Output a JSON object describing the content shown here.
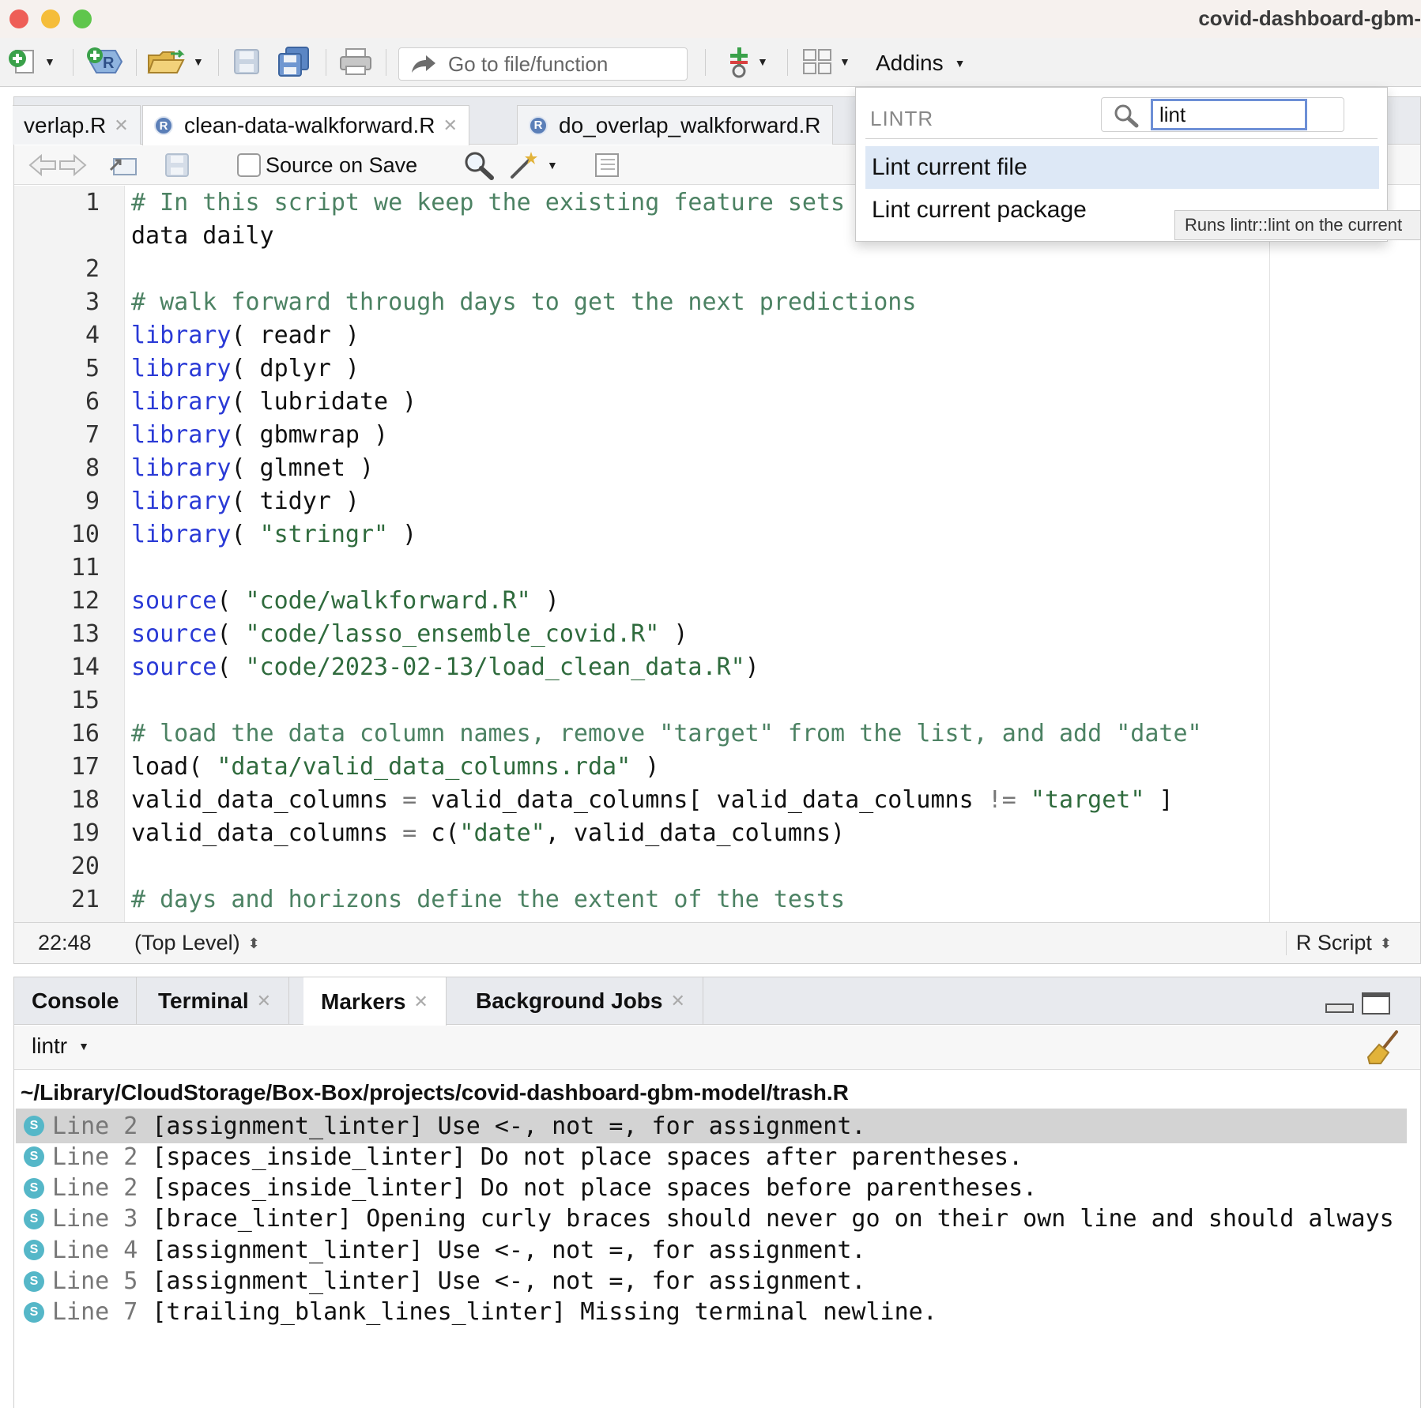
{
  "window": {
    "title": "covid-dashboard-gbm-"
  },
  "toolbar": {
    "goto_placeholder": "Go to file/function",
    "addins_label": "Addins"
  },
  "editor": {
    "tabs": [
      {
        "label": "verlap.R",
        "active": false
      },
      {
        "label": "clean-data-walkforward.R",
        "active": true
      },
      {
        "label": "do_overlap_walkforward.R",
        "active": false
      }
    ],
    "source_on_save_label": "Source on Save",
    "lines": [
      {
        "n": "1",
        "text": "# In this script we keep the existing feature sets"
      },
      {
        "n": "",
        "text": "data daily"
      },
      {
        "n": "2",
        "text": ""
      },
      {
        "n": "3",
        "text": "# walk forward through days to get the next predictions"
      },
      {
        "n": "4",
        "text": "library( readr )"
      },
      {
        "n": "5",
        "text": "library( dplyr )"
      },
      {
        "n": "6",
        "text": "library( lubridate )"
      },
      {
        "n": "7",
        "text": "library( gbmwrap )"
      },
      {
        "n": "8",
        "text": "library( glmnet )"
      },
      {
        "n": "9",
        "text": "library( tidyr )"
      },
      {
        "n": "10",
        "text": "library( \"stringr\" )"
      },
      {
        "n": "11",
        "text": ""
      },
      {
        "n": "12",
        "text": "source( \"code/walkforward.R\" )"
      },
      {
        "n": "13",
        "text": "source( \"code/lasso_ensemble_covid.R\" )"
      },
      {
        "n": "14",
        "text": "source( \"code/2023-02-13/load_clean_data.R\")"
      },
      {
        "n": "15",
        "text": ""
      },
      {
        "n": "16",
        "text": "# load the data column names, remove \"target\" from the list, and add \"date\""
      },
      {
        "n": "17",
        "text": "load( \"data/valid_data_columns.rda\" )"
      },
      {
        "n": "18",
        "text": "valid_data_columns = valid_data_columns[ valid_data_columns != \"target\" ]"
      },
      {
        "n": "19",
        "text": "valid_data_columns = c(\"date\", valid_data_columns)"
      },
      {
        "n": "20",
        "text": ""
      },
      {
        "n": "21",
        "text": "# days and horizons define the extent of the tests"
      }
    ],
    "status": {
      "position": "22:48",
      "scope": "(Top Level)",
      "file_type": "R Script"
    }
  },
  "addins_menu": {
    "group_label": "LINTR",
    "search_value": "lint",
    "items": [
      {
        "label": "Lint current file",
        "selected": true
      },
      {
        "label": "Lint current package",
        "selected": false
      }
    ],
    "tooltip": "Runs lintr::lint on the current"
  },
  "bottom": {
    "tabs": [
      {
        "label": "Console",
        "closable": false,
        "active": false
      },
      {
        "label": "Terminal",
        "closable": true,
        "active": false
      },
      {
        "label": "Markers",
        "closable": true,
        "active": true
      },
      {
        "label": "Background Jobs",
        "closable": true,
        "active": false
      }
    ],
    "marker_source": "lintr",
    "file_path": "~/Library/CloudStorage/Box-Box/projects/covid-dashboard-gbm-model/trash.R",
    "markers": [
      {
        "badge": "S",
        "line": "Line 2",
        "message": "[assignment_linter] Use <-, not =, for assignment.",
        "selected": true
      },
      {
        "badge": "S",
        "line": "Line 2",
        "message": "[spaces_inside_linter] Do not place spaces after parentheses.",
        "selected": false
      },
      {
        "badge": "S",
        "line": "Line 2",
        "message": "[spaces_inside_linter] Do not place spaces before parentheses.",
        "selected": false
      },
      {
        "badge": "S",
        "line": "Line 3",
        "message": "[brace_linter] Opening curly braces should never go on their own line and should always",
        "selected": false
      },
      {
        "badge": "S",
        "line": "Line 4",
        "message": "[assignment_linter] Use <-, not =, for assignment.",
        "selected": false
      },
      {
        "badge": "S",
        "line": "Line 5",
        "message": "[assignment_linter] Use <-, not =, for assignment.",
        "selected": false
      },
      {
        "badge": "S",
        "line": "Line 7",
        "message": "[trailing_blank_lines_linter] Missing terminal newline.",
        "selected": false
      }
    ]
  }
}
